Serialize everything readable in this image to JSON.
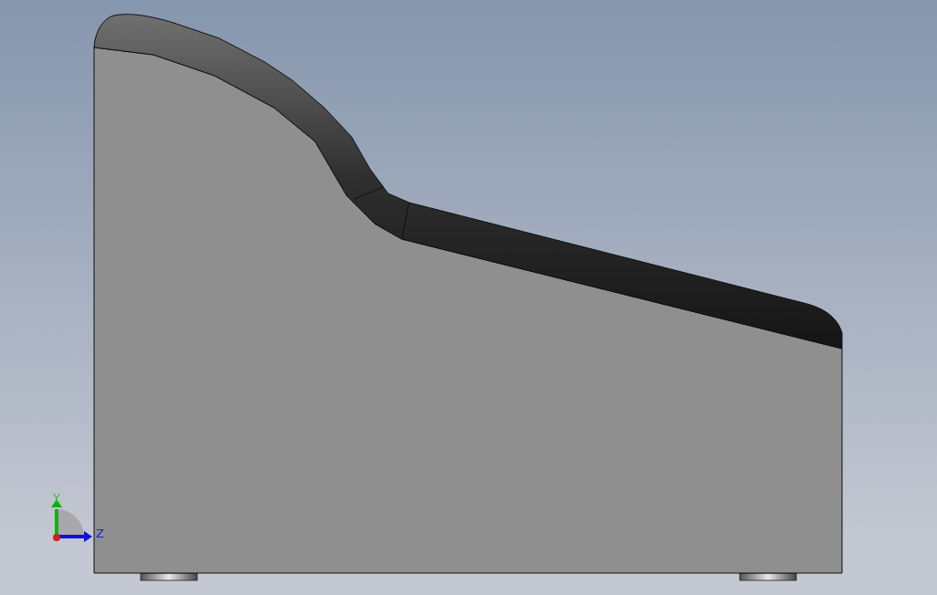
{
  "viewport": {
    "triad": {
      "axes": [
        {
          "label": "Y",
          "kind": "y"
        },
        {
          "label": "Z",
          "kind": "z"
        }
      ]
    }
  }
}
